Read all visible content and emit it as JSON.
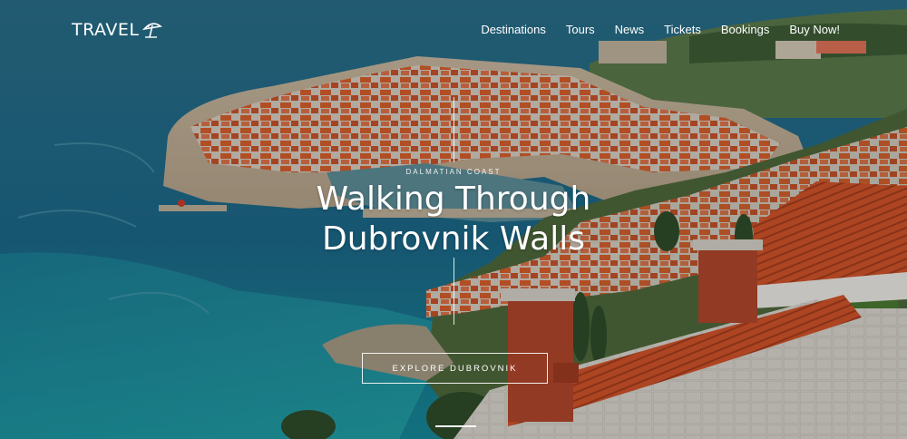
{
  "header": {
    "logo_text": "TRAVEL",
    "logo_icon": "beach-umbrella-icon"
  },
  "nav": {
    "items": [
      "Destinations",
      "Tours",
      "News",
      "Tickets",
      "Bookings",
      "Buy Now!"
    ]
  },
  "hero": {
    "eyebrow": "DALMATIAN COAST",
    "headline_line1": "Walking Through",
    "headline_line2": "Dubrovnik Walls",
    "cta_label": "EXPLORE DUBROVNIK",
    "background_description_icon": "dubrovnik-old-town-photo"
  },
  "colors": {
    "sea": "#1f6f8f",
    "roof": "#d9602c",
    "text": "#ffffff"
  }
}
